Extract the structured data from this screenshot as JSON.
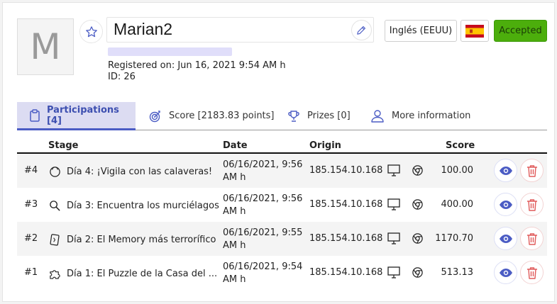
{
  "profile": {
    "avatar_letter": "M",
    "name": "Marian2",
    "registered": "Registered on: Jun 16, 2021 9:54 AM h",
    "id": "ID: 26",
    "language": "Inglés (EEUU)",
    "status": "Accepted"
  },
  "tabs": [
    {
      "label": "Participations [4]",
      "icon": "clipboard-icon"
    },
    {
      "label": "Score [2183.83 points]",
      "icon": "target-icon"
    },
    {
      "label": "Prizes [0]",
      "icon": "trophy-icon"
    },
    {
      "label": "More information",
      "icon": "user-icon"
    }
  ],
  "table": {
    "headers": {
      "stage": "Stage",
      "date": "Date",
      "origin": "Origin",
      "score": "Score"
    },
    "rows": [
      {
        "num": "#4",
        "stage": "Día 4: ¡Vigila con las calaveras!",
        "date": "06/16/2021, 9:56 AM h",
        "origin": "185.154.10.168",
        "score": "100.00"
      },
      {
        "num": "#3",
        "stage": "Día 3: Encuentra los murciélagos",
        "date": "06/16/2021, 9:56 AM h",
        "origin": "185.154.10.168",
        "score": "400.00"
      },
      {
        "num": "#2",
        "stage": "Día 2: El Memory más terrorífico",
        "date": "06/16/2021, 9:55 AM h",
        "origin": "185.154.10.168",
        "score": "1170.70"
      },
      {
        "num": "#1",
        "stage": "Día 1: El Puzzle de la Casa del ...",
        "date": "06/16/2021, 9:54 AM h",
        "origin": "185.154.10.168",
        "score": "513.13"
      }
    ]
  },
  "colors": {
    "accent": "#4b5cc4",
    "accepted": "#4cae0c",
    "danger": "#e05a5a"
  }
}
